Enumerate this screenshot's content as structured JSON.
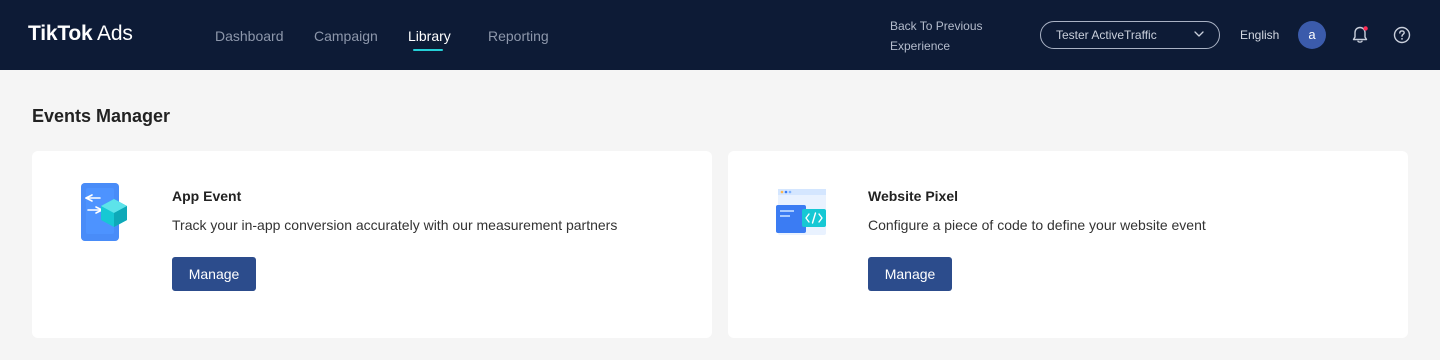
{
  "header": {
    "logo_main": "TikTok",
    "logo_suffix": "Ads",
    "nav": [
      {
        "label": "Dashboard",
        "active": false
      },
      {
        "label": "Campaign",
        "active": false
      },
      {
        "label": "Library",
        "active": true
      },
      {
        "label": "Reporting",
        "active": false
      }
    ],
    "back_link": "Back To Previous Experience",
    "account": "Tester ActiveTraffic",
    "language": "English",
    "avatar_initial": "a",
    "icons": [
      "chevron-down-icon",
      "bell-icon",
      "help-icon"
    ],
    "notification_dot_color": "#fe2c55",
    "accent_color": "#25d0d8"
  },
  "page": {
    "title": "Events Manager"
  },
  "cards": [
    {
      "title": "App Event",
      "description": "Track your in-app conversion accurately with our measurement partners",
      "button": "Manage",
      "icon": "app-event-illustration-icon"
    },
    {
      "title": "Website Pixel",
      "description": "Configure a piece of code to define your website event",
      "button": "Manage",
      "icon": "website-pixel-illustration-icon"
    }
  ],
  "colors": {
    "header_bg": "#0d1b36",
    "button_bg": "#2c4c8c",
    "page_bg": "#f5f5f5"
  }
}
